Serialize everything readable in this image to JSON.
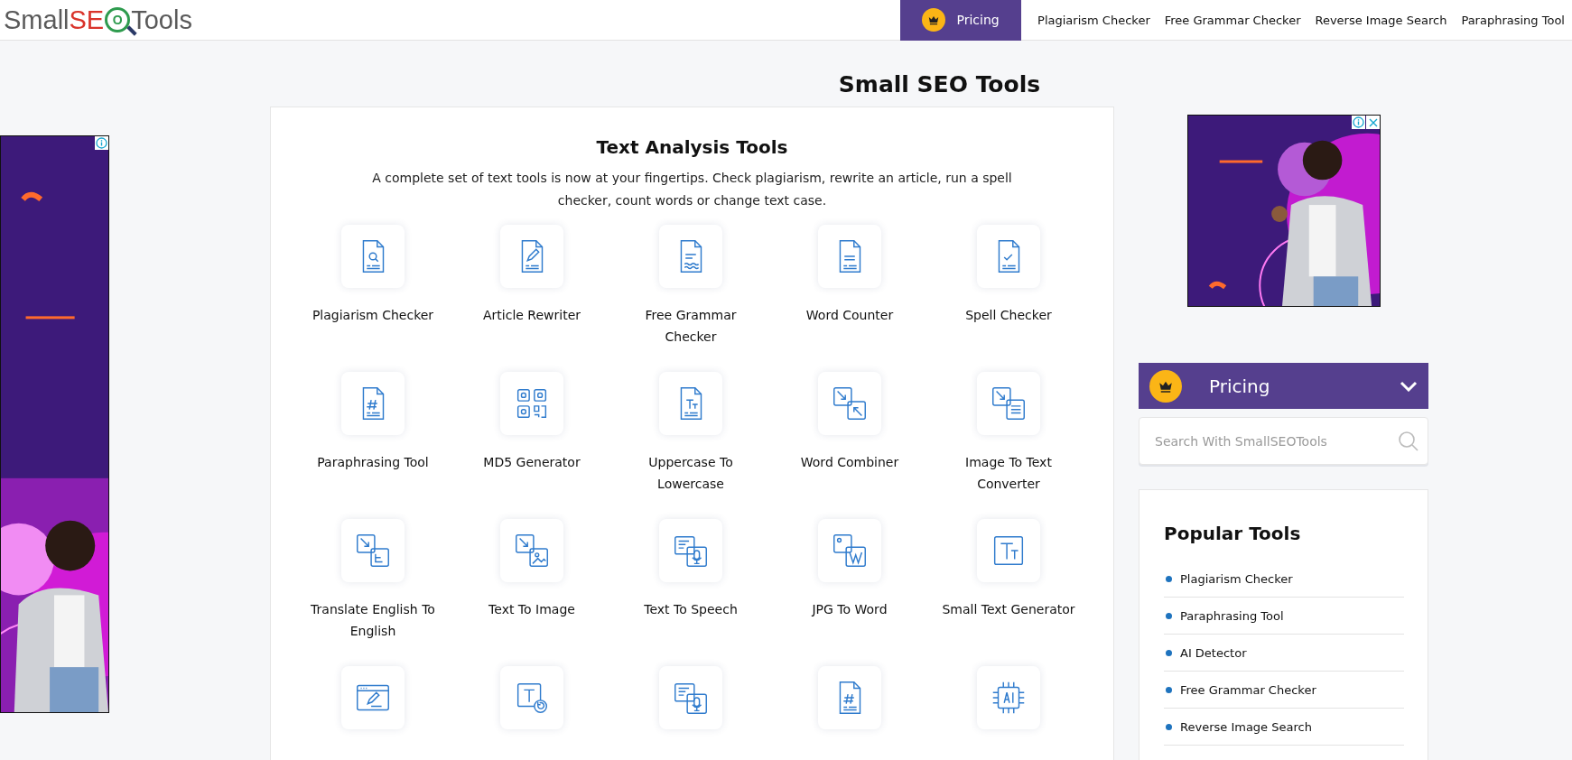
{
  "header": {
    "logo": [
      {
        "text": "Small",
        "color": "#5a5a5a"
      },
      {
        "text": "SE",
        "color": "#d9342b"
      },
      {
        "text": "O",
        "color": "#2e9b4e"
      },
      {
        "text": "Tools",
        "color": "#5a5a5a"
      }
    ],
    "pricing": "Pricing",
    "nav": [
      "Plagiarism Checker",
      "Free Grammar Checker",
      "Reverse Image Search",
      "Paraphrasing Tool"
    ]
  },
  "page_title": "Small SEO Tools",
  "main": {
    "heading": "Text Analysis Tools",
    "description": "A complete set of text tools is now at your fingertips. Check plagiarism, rewrite an article, run a spell checker, count words or change text case.",
    "tools": [
      {
        "kind": "labeled",
        "label": "Plagiarism Checker"
      },
      {
        "kind": "labeled",
        "label": "Article Rewriter"
      },
      {
        "kind": "labeled",
        "label": "Free Grammar Checker"
      },
      {
        "kind": "labeled",
        "label": "Word Counter"
      },
      {
        "kind": "labeled",
        "label": "Spell Checker"
      },
      {
        "kind": "labeled",
        "label": "Paraphrasing Tool"
      },
      {
        "kind": "labeled",
        "label": "MD5 Generator"
      },
      {
        "kind": "labeled",
        "label": "Uppercase To Lowercase"
      },
      {
        "kind": "labeled",
        "label": "Word Combiner"
      },
      {
        "kind": "labeled",
        "label": "Image To Text Converter"
      },
      {
        "kind": "labeled",
        "label": "Translate English To English"
      },
      {
        "kind": "labeled",
        "label": "Text To Image"
      },
      {
        "kind": "labeled",
        "label": "Text To Speech"
      },
      {
        "kind": "labeled",
        "label": "JPG To Word"
      },
      {
        "kind": "labeled",
        "label": "Small Text Generator"
      },
      {
        "kind": "cut"
      },
      {
        "kind": "cut"
      },
      {
        "kind": "cut"
      },
      {
        "kind": "cut"
      },
      {
        "kind": "cut"
      }
    ]
  },
  "sidebar": {
    "pricing": "Pricing",
    "search": {
      "placeholder": "Search With SmallSEOTools"
    },
    "popular": {
      "heading": "Popular Tools",
      "items": [
        "Plagiarism Checker",
        "Paraphrasing Tool",
        "AI Detector",
        "Free Grammar Checker",
        "Reverse Image Search"
      ]
    }
  }
}
